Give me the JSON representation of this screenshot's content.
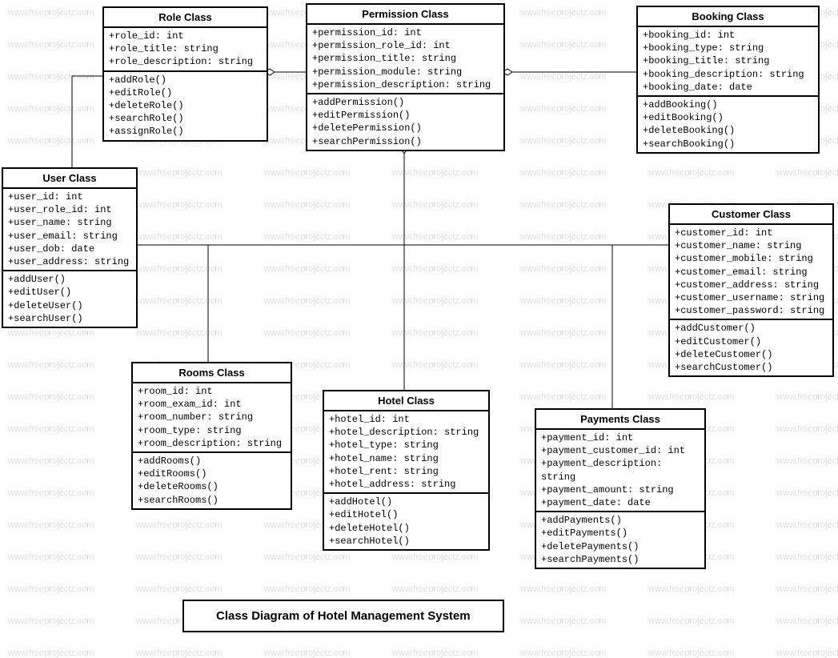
{
  "watermark_text": "www.freeprojectz.com",
  "title": "Class Diagram of Hotel Management System",
  "classes": {
    "role": {
      "name": "Role Class",
      "attrs": [
        "+role_id: int",
        "+role_title: string",
        "+role_description: string"
      ],
      "methods": [
        "+addRole()",
        "+editRole()",
        "+deleteRole()",
        "+searchRole()",
        "+assignRole()"
      ]
    },
    "permission": {
      "name": "Permission Class",
      "attrs": [
        "+permission_id: int",
        "+permission_role_id: int",
        "+permission_title: string",
        "+permission_module: string",
        "+permission_description: string"
      ],
      "methods": [
        "+addPermission()",
        "+editPermission()",
        "+deletePermission()",
        "+searchPermission()"
      ]
    },
    "booking": {
      "name": "Booking Class",
      "attrs": [
        "+booking_id: int",
        "+booking_type: string",
        "+booking_title: string",
        "+booking_description: string",
        "+booking_date: date"
      ],
      "methods": [
        "+addBooking()",
        "+editBooking()",
        "+deleteBooking()",
        "+searchBooking()"
      ]
    },
    "user": {
      "name": "User Class",
      "attrs": [
        "+user_id: int",
        "+user_role_id: int",
        "+user_name: string",
        "+user_email: string",
        "+user_dob: date",
        "+user_address: string"
      ],
      "methods": [
        "+addUser()",
        "+editUser()",
        "+deleteUser()",
        "+searchUser()"
      ]
    },
    "customer": {
      "name": "Customer Class",
      "attrs": [
        "+customer_id: int",
        "+customer_name: string",
        "+customer_mobile: string",
        "+customer_email: string",
        "+customer_address: string",
        "+customer_username: string",
        "+customer_password: string"
      ],
      "methods": [
        "+addCustomer()",
        "+editCustomer()",
        "+deleteCustomer()",
        "+searchCustomer()"
      ]
    },
    "rooms": {
      "name": "Rooms Class",
      "attrs": [
        "+room_id: int",
        "+room_exam_id: int",
        "+room_number: string",
        "+room_type: string",
        "+room_description: string"
      ],
      "methods": [
        "+addRooms()",
        "+editRooms()",
        "+deleteRooms()",
        "+searchRooms()"
      ]
    },
    "hotel": {
      "name": "Hotel Class",
      "attrs": [
        "+hotel_id: int",
        "+hotel_description: string",
        "+hotel_type: string",
        "+hotel_name: string",
        "+hotel_rent: string",
        "+hotel_address: string"
      ],
      "methods": [
        "+addHotel()",
        "+editHotel()",
        "+deleteHotel()",
        "+searchHotel()"
      ]
    },
    "payments": {
      "name": "Payments Class",
      "attrs": [
        "+payment_id: int",
        "+payment_customer_id: int",
        "+payment_description: string",
        "+payment_amount: string",
        "+payment_date: date"
      ],
      "methods": [
        "+addPayments()",
        "+editPayments()",
        "+deletePayments()",
        "+searchPayments()"
      ]
    }
  }
}
